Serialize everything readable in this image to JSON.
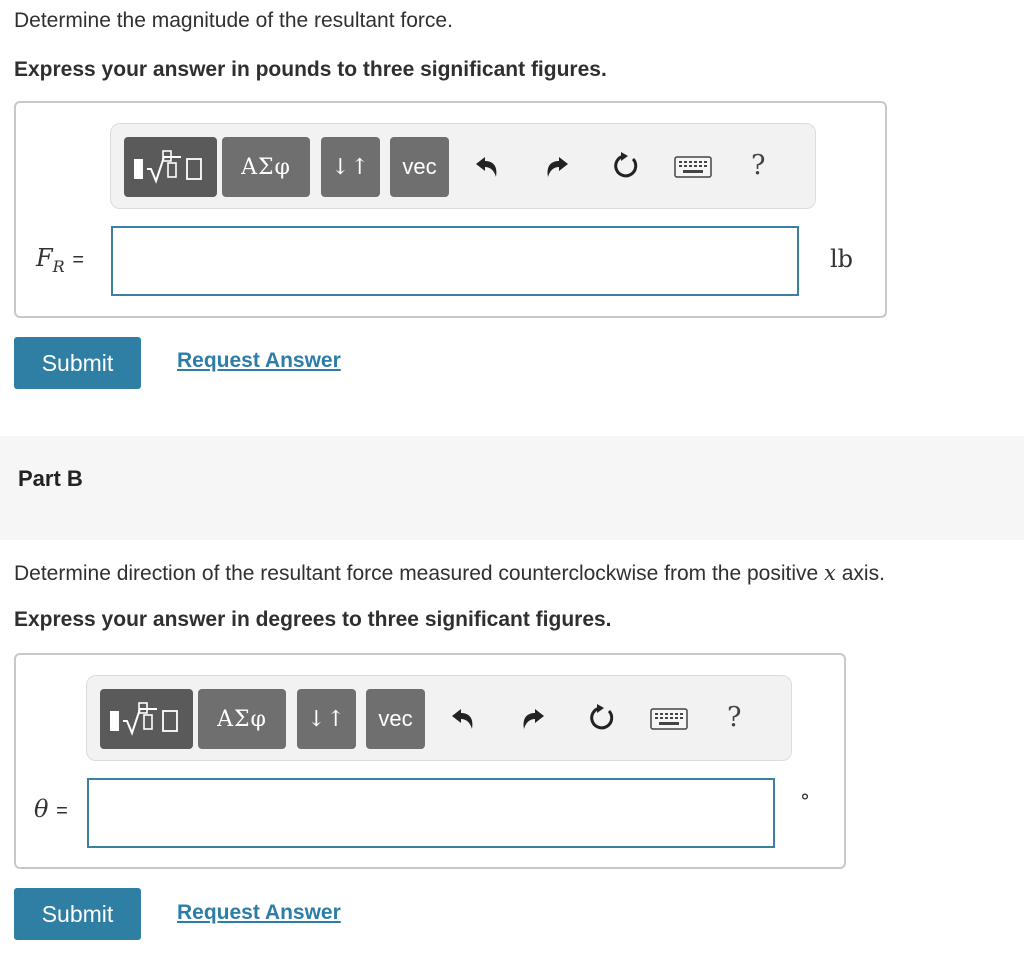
{
  "partA": {
    "question": "Determine the magnitude of the resultant force.",
    "instruction": "Express your answer in pounds to three significant figures.",
    "toolbar": {
      "template_icon": "fraction-sqrt-template-icon",
      "greek_label": "ΑΣφ",
      "updown_label": "↓↑",
      "vec_label": "vec",
      "help_label": "?"
    },
    "variable_main": "F",
    "variable_sub": "R",
    "equals": "=",
    "input_value": "",
    "unit": "lb",
    "submit_label": "Submit",
    "request_label": "Request Answer"
  },
  "partB": {
    "title": "Part B",
    "question_prefix": "Determine direction of the resultant force measured counterclockwise from the positive ",
    "question_var": "x",
    "question_suffix": " axis.",
    "instruction": "Express your answer in degrees to three significant figures.",
    "toolbar": {
      "template_icon": "fraction-sqrt-template-icon",
      "greek_label": "ΑΣφ",
      "updown_label": "↓↑",
      "vec_label": "vec",
      "help_label": "?"
    },
    "variable": "θ",
    "equals": "=",
    "input_value": "",
    "unit": "°",
    "submit_label": "Submit",
    "request_label": "Request Answer"
  },
  "colors": {
    "accent": "#2f7ea3",
    "link": "#2c7da8",
    "input_border": "#3d7f9e",
    "toolbar_button": "#6f6f6f"
  }
}
